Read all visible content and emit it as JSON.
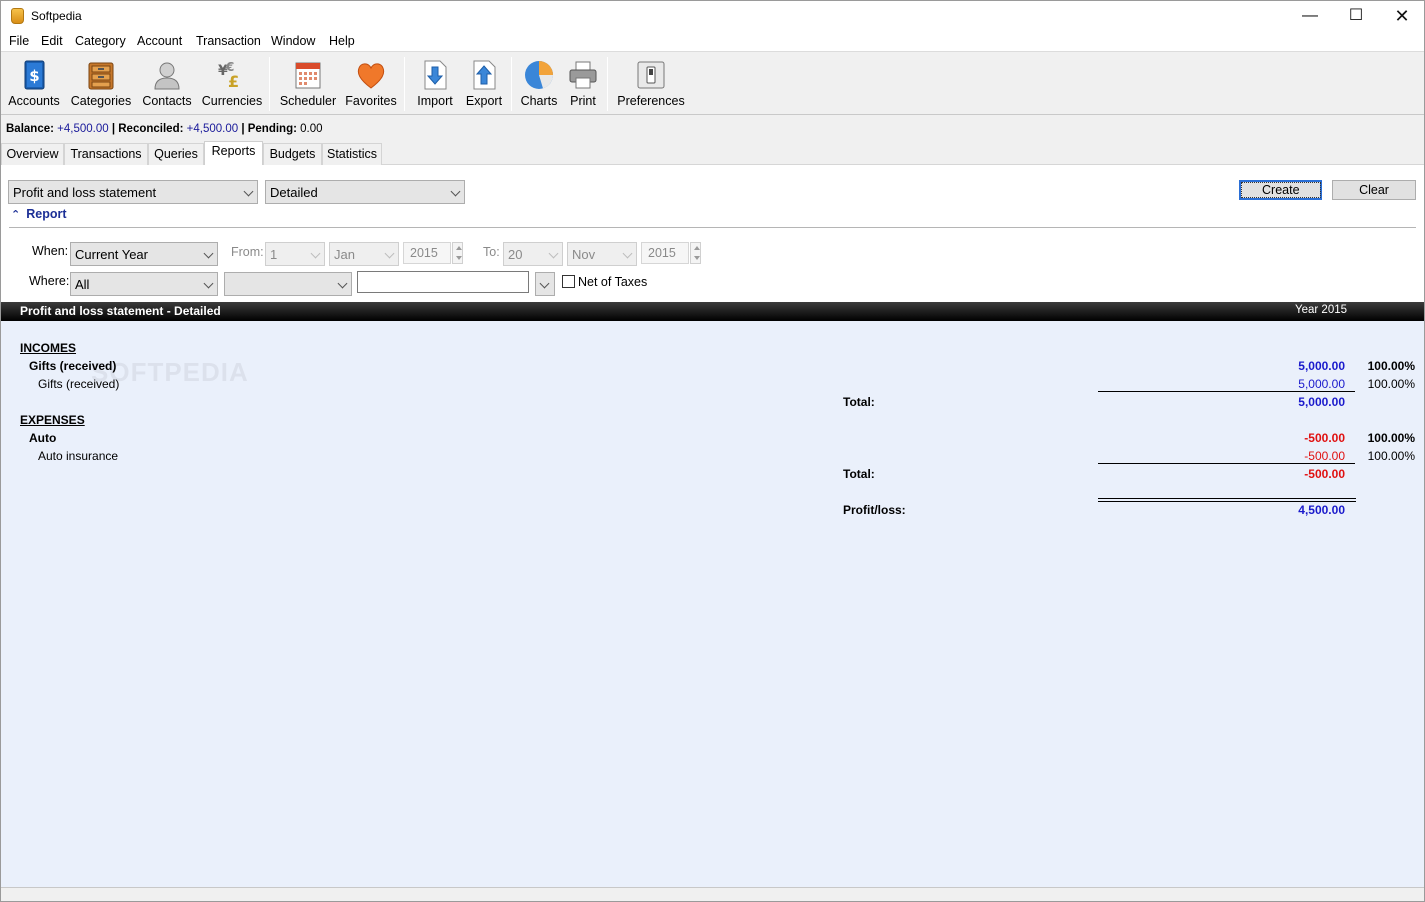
{
  "window": {
    "title": "Softpedia",
    "minimize": "—",
    "maximize": "☐",
    "close": "✕"
  },
  "menu": [
    "File",
    "Edit",
    "Category",
    "Account",
    "Transaction",
    "Window",
    "Help"
  ],
  "toolbar": {
    "accounts": "Accounts",
    "categories": "Categories",
    "contacts": "Contacts",
    "currencies": "Currencies",
    "scheduler": "Scheduler",
    "favorites": "Favorites",
    "import": "Import",
    "export": "Export",
    "charts": "Charts",
    "print": "Print",
    "preferences": "Preferences"
  },
  "balance": {
    "balance_label": "Balance:",
    "balance_value": "+4,500.00",
    "reconciled_label": "| Reconciled:",
    "reconciled_value": "+4,500.00",
    "pending_label": "| Pending:",
    "pending_value": "0.00"
  },
  "tabs": [
    "Overview",
    "Transactions",
    "Queries",
    "Reports",
    "Budgets",
    "Statistics"
  ],
  "active_tab": "Reports",
  "panel": {
    "report_type": "Profit and loss statement",
    "detail_level": "Detailed",
    "create_label": "Create",
    "clear_label": "Clear",
    "report_toggle": "Report",
    "when_label": "When:",
    "when_value": "Current Year",
    "from_label": "From:",
    "from_day": "1",
    "from_month": "Jan",
    "from_year": "2015",
    "to_label": "To:",
    "to_day": "20",
    "to_month": "Nov",
    "to_year": "2015",
    "where_label": "Where:",
    "where_value": "All",
    "where_sub_value": "",
    "where_text": "",
    "net_of_taxes_label": "Net of Taxes"
  },
  "report": {
    "title": "Profit and loss statement - Detailed",
    "period": "Year 2015",
    "incomes_heading": "INCOMES",
    "income_group": "Gifts (received)",
    "income_group_value": "5,000.00",
    "income_group_pct": "100.00%",
    "income_item": "Gifts (received)",
    "income_item_value": "5,000.00",
    "income_item_pct": "100.00%",
    "income_total_label": "Total:",
    "income_total_value": "5,000.00",
    "expenses_heading": "EXPENSES",
    "expense_group": "Auto",
    "expense_group_value": "-500.00",
    "expense_group_pct": "100.00%",
    "expense_item": "Auto insurance",
    "expense_item_value": "-500.00",
    "expense_item_pct": "100.00%",
    "expense_total_label": "Total:",
    "expense_total_value": "-500.00",
    "profit_label": "Profit/loss:",
    "profit_value": "4,500.00"
  },
  "colors": {
    "positive": "#1a1acc",
    "negative": "#e01010",
    "report_bg": "#eaf0fb",
    "accent": "#2b6fd6"
  },
  "watermark": "SOFTPEDIA"
}
